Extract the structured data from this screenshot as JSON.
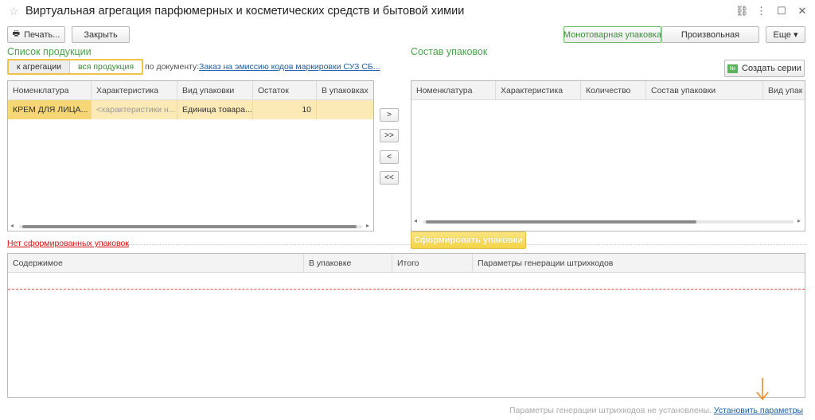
{
  "window": {
    "title": "Виртуальная агрегация парфюмерных и косметических средств и бытовой химии",
    "controls": [
      "⛓",
      "⋮",
      "☐",
      "✕"
    ]
  },
  "toolbar": {
    "print_label": "Печать...",
    "close_label": "Закрыть",
    "mono_label": "Монотоварная упаковка",
    "arbitrary_label": "Произвольная",
    "more_label": "Еще ▾"
  },
  "products": {
    "title": "Список продукции",
    "filter_to_aggregate": "к агрегации",
    "filter_all": "вся продукция",
    "doc_label": "по документу:",
    "doc_link": "Заказ на эмиссию кодов маркировки СУЗ СБ...",
    "columns": [
      "Номенклатура",
      "Характеристика",
      "Вид упаковки",
      "Остаток",
      "В упаковках"
    ],
    "rows": [
      [
        "КРЕМ ДЛЯ ЛИЦА...",
        "<характеристики н...",
        "Единица товара...",
        "10",
        ""
      ]
    ]
  },
  "move_buttons": [
    ">",
    ">>",
    "<",
    "<<"
  ],
  "packages": {
    "title": "Состав упаковок",
    "create_series_label": "Создать серии",
    "columns": [
      "Номенклатура",
      "Характеристика",
      "Количество",
      "Состав упаковки",
      "Вид упак"
    ]
  },
  "no_packages_link": "Нет сформированных упаковок",
  "form_packages_label": "Сформировать упаковки",
  "contents": {
    "columns": [
      "Содержимое",
      "В упаковке",
      "Итого",
      "Параметры генерации штрихкодов"
    ]
  },
  "footer": {
    "status": "Параметры генерации штрихкодов не установлены.",
    "set_params_link": "Установить параметры"
  },
  "colors": {
    "accent_green": "#4aa34a",
    "selection_yellow": "#fbeab5",
    "error_red": "#d11111",
    "link_blue": "#1a5ea8",
    "arrow_orange": "#f08a2a"
  }
}
